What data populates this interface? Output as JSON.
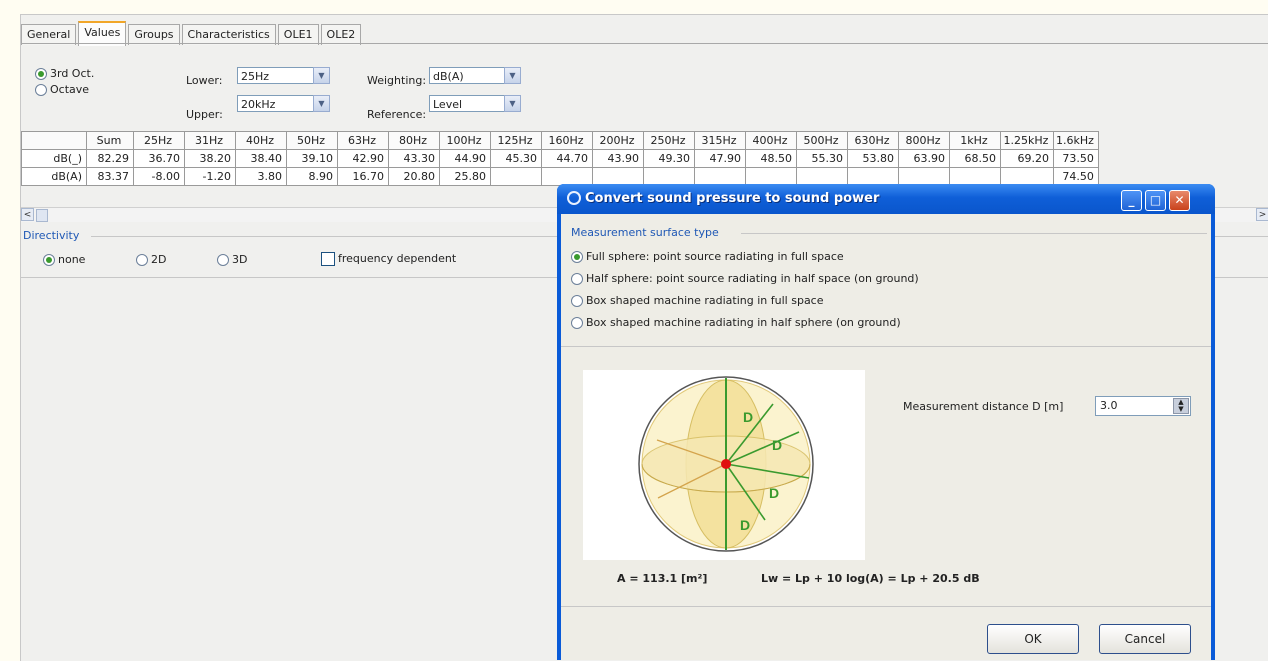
{
  "tabs": [
    "General",
    "Values",
    "Groups",
    "Characteristics",
    "OLE1",
    "OLE2"
  ],
  "band": {
    "options": [
      "3rd Oct.",
      "Octave"
    ],
    "lower_label": "Lower:",
    "lower_value": "25Hz",
    "upper_label": "Upper:",
    "upper_value": "20kHz",
    "weighting_label": "Weighting:",
    "weighting_value": "dB(A)",
    "reference_label": "Reference:",
    "reference_value": "Level"
  },
  "table": {
    "headers": [
      "",
      "Sum",
      "25Hz",
      "31Hz",
      "40Hz",
      "50Hz",
      "63Hz",
      "80Hz",
      "100Hz",
      "125Hz",
      "160Hz",
      "200Hz",
      "250Hz",
      "315Hz",
      "400Hz",
      "500Hz",
      "630Hz",
      "800Hz",
      "1kHz",
      "1.25kHz",
      "1.6kHz"
    ],
    "rows": [
      [
        "dB(_)",
        "82.29",
        "36.70",
        "38.20",
        "38.40",
        "39.10",
        "42.90",
        "43.30",
        "44.90",
        "45.30",
        "44.70",
        "43.90",
        "49.30",
        "47.90",
        "48.50",
        "55.30",
        "53.80",
        "63.90",
        "68.50",
        "69.20",
        "73.50"
      ],
      [
        "dB(A)",
        "83.37",
        "-8.00",
        "-1.20",
        "3.80",
        "8.90",
        "16.70",
        "20.80",
        "25.80",
        "",
        "",
        "",
        "",
        "",
        "",
        "",
        "",
        "",
        "",
        "",
        "74.50"
      ]
    ]
  },
  "directivity": {
    "title": "Directivity",
    "options": [
      "none",
      "2D",
      "3D"
    ],
    "checkbox": "frequency dependent"
  },
  "dialog": {
    "title": "Convert sound pressure to sound power",
    "group_title": "Measurement surface type",
    "options": [
      "Full sphere: point source radiating in full space",
      "Half sphere: point source radiating in half space (on ground)",
      "Box shaped machine radiating in full space",
      "Box shaped machine radiating in half sphere (on ground)"
    ],
    "distance_label": "Measurement distance D [m]",
    "distance_value": "3.0",
    "sphere_label": "D",
    "formula_area": "A = 113.1 [m²]",
    "formula_power": "Lw = Lp + 10 log(A) = Lp + 20.5 dB",
    "ok": "OK",
    "cancel": "Cancel"
  }
}
